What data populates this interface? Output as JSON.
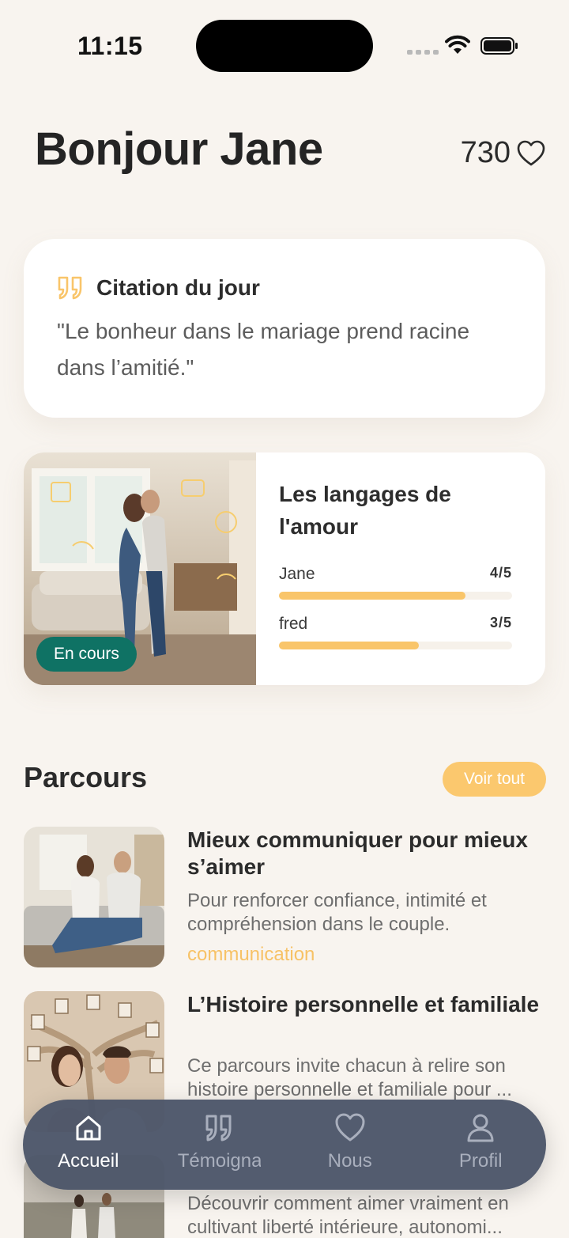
{
  "status_bar": {
    "time": "11:15"
  },
  "header": {
    "greeting": "Bonjour Jane",
    "score": "730"
  },
  "quote": {
    "title": "Citation du jour",
    "text": "\"Le bonheur dans le mariage prend racine dans l’amitié.\""
  },
  "feature": {
    "badge": "En cours",
    "title": "Les langages de l'amour",
    "progress": [
      {
        "name": "Jane",
        "value_label": "4/5",
        "fraction": 0.8
      },
      {
        "name": "fred",
        "value_label": "3/5",
        "fraction": 0.6
      }
    ]
  },
  "parcours": {
    "title": "Parcours",
    "see_all": "Voir tout",
    "items": [
      {
        "title": "Mieux communiquer pour mieux s’aimer",
        "description": "Pour renforcer confiance, intimité et compréhension dans le couple.",
        "tag": "communication"
      },
      {
        "title": "L’Histoire personnelle et familiale",
        "description_line1": "Ce parcours invite chacun à relire son",
        "description_line2": "histoire personnelle et familiale pour ..."
      },
      {
        "description_line1": "Découvrir comment aimer vraiment en",
        "description_line2": "cultivant liberté intérieure, autonomi..."
      }
    ]
  },
  "tabbar": {
    "tabs": [
      {
        "label": "Accueil",
        "icon": "home-icon",
        "active": true
      },
      {
        "label": "Témoignages",
        "icon": "quote-icon"
      },
      {
        "label": "Nous",
        "icon": "heart-icon"
      },
      {
        "label": "Profil",
        "icon": "user-icon"
      }
    ]
  },
  "colors": {
    "accent": "#fbc86e",
    "badge": "#0f7264",
    "tabbar": "#4c5569",
    "background": "#f8f4ef"
  }
}
